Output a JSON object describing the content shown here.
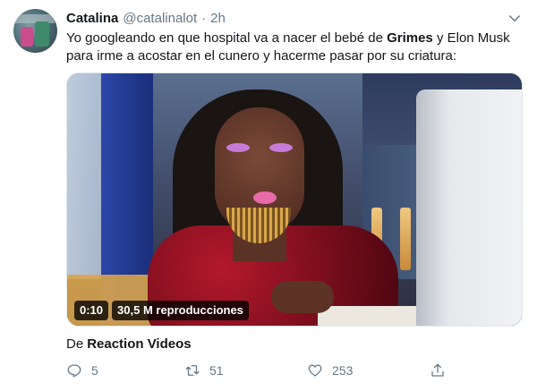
{
  "tweet": {
    "author_name": "Catalina",
    "author_handle": "@catalinalot",
    "separator": "·",
    "timestamp": "2h",
    "text_part1": "Yo googleando en que hospital va a nacer el bebé de ",
    "text_bold": "Grimes",
    "text_part2": " y Elon Musk para irme a acostar en el cunero y hacerme pasar por su criatura:"
  },
  "media": {
    "duration": "0:10",
    "views": "30,5 M reproducciones"
  },
  "source": {
    "label": "De",
    "name": "Reaction Videos"
  },
  "actions": {
    "reply_count": "5",
    "retweet_count": "51",
    "like_count": "253"
  },
  "icons": {
    "more": "chevron-down-icon",
    "reply": "reply-icon",
    "retweet": "retweet-icon",
    "like": "heart-icon",
    "share": "share-icon"
  },
  "colors": {
    "text": "#14171a",
    "secondary": "#657786",
    "border": "#e1e8ed"
  }
}
